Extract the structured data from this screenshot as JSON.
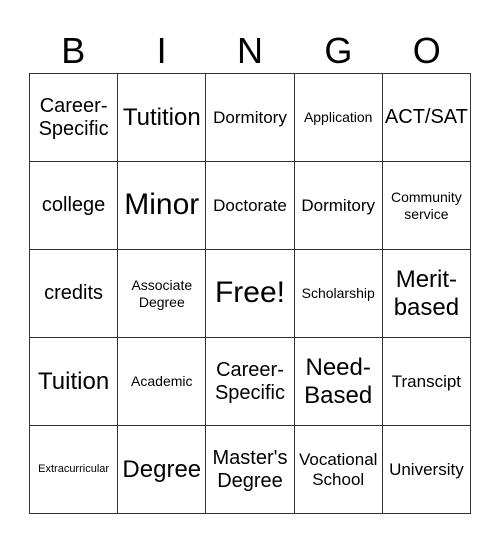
{
  "header": {
    "letters": [
      "B",
      "I",
      "N",
      "G",
      "O"
    ]
  },
  "board": {
    "rows": [
      [
        {
          "text": "Career-\nSpecific",
          "size": "lg"
        },
        {
          "text": "Tutition",
          "size": "xl"
        },
        {
          "text": "Dormitory",
          "size": "md"
        },
        {
          "text": "Application",
          "size": "sm"
        },
        {
          "text": "ACT/SAT",
          "size": "lg"
        }
      ],
      [
        {
          "text": "college",
          "size": "lg"
        },
        {
          "text": "Minor",
          "size": "xxl"
        },
        {
          "text": "Doctorate",
          "size": "md"
        },
        {
          "text": "Dormitory",
          "size": "md"
        },
        {
          "text": "Community\nservice",
          "size": "sm"
        }
      ],
      [
        {
          "text": "credits",
          "size": "lg"
        },
        {
          "text": "Associate\nDegree",
          "size": "sm"
        },
        {
          "text": "Free!",
          "size": "xxl"
        },
        {
          "text": "Scholarship",
          "size": "sm"
        },
        {
          "text": "Merit-\nbased",
          "size": "xl"
        }
      ],
      [
        {
          "text": "Tuition",
          "size": "xl"
        },
        {
          "text": "Academic",
          "size": "sm"
        },
        {
          "text": "Career-\nSpecific",
          "size": "lg"
        },
        {
          "text": "Need-\nBased",
          "size": "xl"
        },
        {
          "text": "Transcipt",
          "size": "md"
        }
      ],
      [
        {
          "text": "Extracurricular",
          "size": "xs"
        },
        {
          "text": "Degree",
          "size": "xl"
        },
        {
          "text": "Master's\nDegree",
          "size": "lg"
        },
        {
          "text": "Vocational\nSchool",
          "size": "md"
        },
        {
          "text": "University",
          "size": "md"
        }
      ]
    ]
  }
}
